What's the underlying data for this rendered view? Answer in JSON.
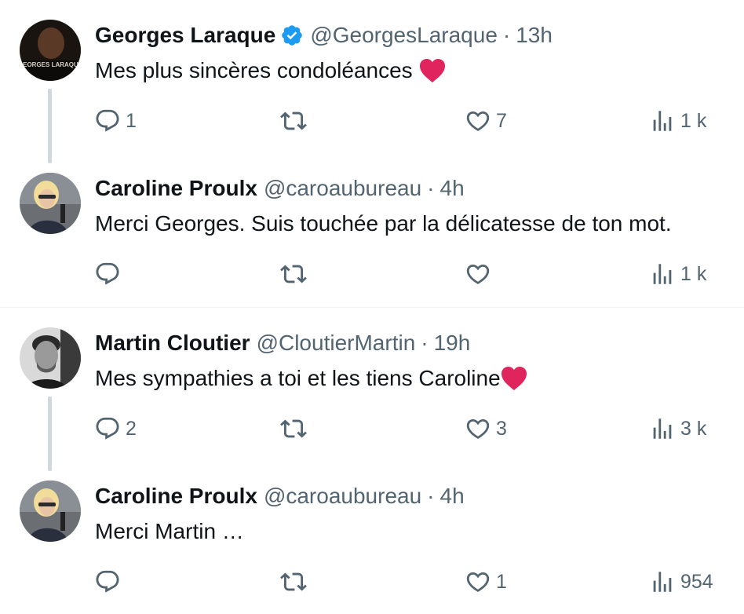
{
  "tweets": [
    {
      "avatar": "georges-laraque-book-cover-avatar",
      "avatar_text": "GEORGES LARAQUE",
      "name": "Georges Laraque",
      "verified": true,
      "handle": "@GeorgesLaraque",
      "separator": "·",
      "time": "13h",
      "text": "Mes plus sincères condoléances",
      "emoji": "red-heart",
      "replies": "1",
      "likes": "7",
      "views": "1 k"
    },
    {
      "avatar": "caroline-proulx-avatar",
      "name": "Caroline Proulx",
      "verified": false,
      "handle": "@caroaubureau",
      "separator": "·",
      "time": "4h",
      "text": "Merci Georges. Suis touchée par la délicatesse de ton mot.",
      "replies": "",
      "likes": "",
      "views": "1 k"
    },
    {
      "avatar": "martin-cloutier-avatar",
      "name": "Martin Cloutier",
      "verified": false,
      "handle": "@CloutierMartin",
      "separator": "·",
      "time": "19h",
      "text": "Mes sympathies a toi et les tiens Caroline",
      "emoji": "red-heart",
      "replies": "2",
      "likes": "3",
      "views": "3 k"
    },
    {
      "avatar": "caroline-proulx-avatar",
      "name": "Caroline Proulx",
      "verified": false,
      "handle": "@caroaubureau",
      "separator": "·",
      "time": "4h",
      "text": "Merci Martin …",
      "replies": "",
      "likes": "1",
      "views": "954"
    }
  ],
  "colors": {
    "text": "#0f1419",
    "secondary": "#536471",
    "verified": "#1d9bf0",
    "heart_emoji": "#e0245e",
    "thread_line": "#cfd9de",
    "divider": "#eff3f4"
  },
  "icons": {
    "reply": "reply-icon",
    "retweet": "retweet-icon",
    "like": "like-icon",
    "views": "views-icon",
    "verified": "verified-badge-icon"
  }
}
